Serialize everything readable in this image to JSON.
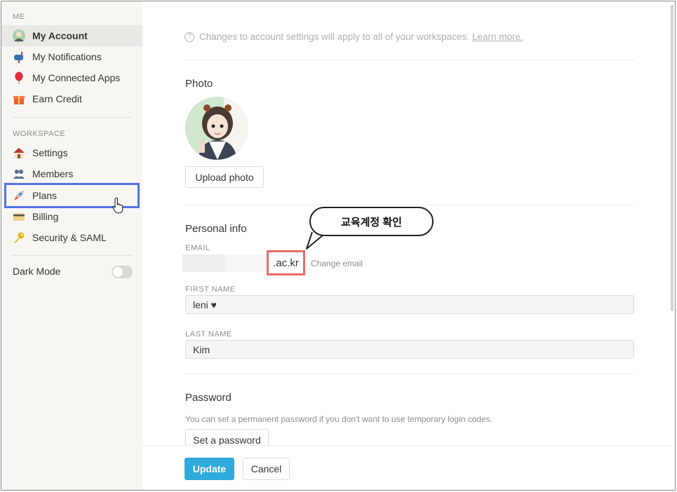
{
  "sidebar": {
    "section_me": "ME",
    "me_items": [
      {
        "label": "My Account",
        "icon": "avatar-icon"
      },
      {
        "label": "My Notifications",
        "icon": "mailbox-icon"
      },
      {
        "label": "My Connected Apps",
        "icon": "balloon-icon"
      },
      {
        "label": "Earn Credit",
        "icon": "gift-icon"
      }
    ],
    "section_workspace": "WORKSPACE",
    "workspace_items": [
      {
        "label": "Settings",
        "icon": "house-icon"
      },
      {
        "label": "Members",
        "icon": "people-icon"
      },
      {
        "label": "Plans",
        "icon": "rocket-icon"
      },
      {
        "label": "Billing",
        "icon": "credit-card-icon"
      },
      {
        "label": "Security & SAML",
        "icon": "key-icon"
      }
    ],
    "dark_mode_label": "Dark Mode",
    "dark_mode_on": false
  },
  "main": {
    "info_text": "Changes to account settings will apply to all of your workspaces.",
    "info_link": "Learn more.",
    "photo_heading": "Photo",
    "upload_button": "Upload photo",
    "personal_heading": "Personal info",
    "email_label": "EMAIL",
    "email_visible_suffix": ".ac.kr",
    "change_email": "Change email",
    "first_name_label": "FIRST NAME",
    "first_name_value": "leni ♥",
    "last_name_label": "LAST NAME",
    "last_name_value": "Kim",
    "password_heading": "Password",
    "password_desc": "You can set a permanent password if you don't want to use temporary login codes.",
    "set_password_button": "Set a password",
    "callout_text": "교육계정 확인"
  },
  "footer": {
    "update_button": "Update",
    "cancel_button": "Cancel"
  },
  "colors": {
    "accent": "#2eaadc",
    "highlight_blue": "#5473e8",
    "highlight_red": "#e96b6b",
    "sidebar_bg": "#f7f6f3"
  }
}
